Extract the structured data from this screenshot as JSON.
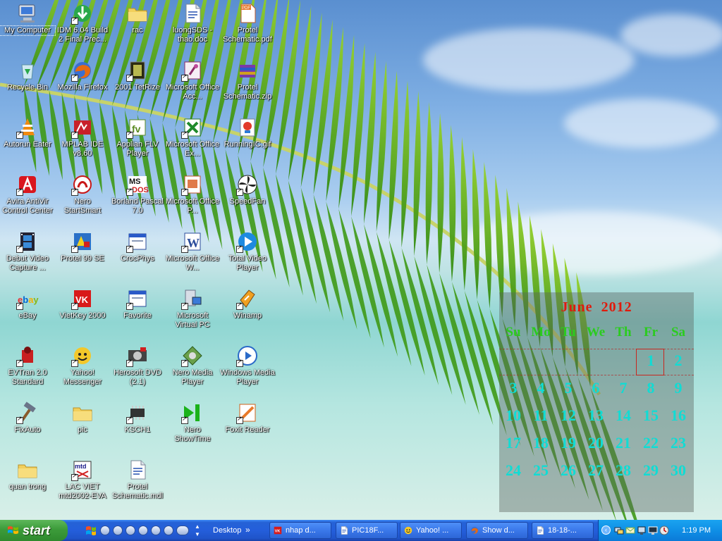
{
  "desktop": {
    "icons": [
      {
        "label": "My Computer",
        "icon": "computer-icon"
      },
      {
        "label": "IDM 6.04 Build 2 Final Prec...",
        "icon": "idm-icon"
      },
      {
        "label": "rac",
        "icon": "folder-icon"
      },
      {
        "label": "luongSDS - thao.doc",
        "icon": "word-doc-icon"
      },
      {
        "label": "Protel Schematic.pdf",
        "icon": "pdf-icon"
      },
      {
        "label": "Recycle Bin",
        "icon": "recycle-bin-icon"
      },
      {
        "label": "Mozilla Firefox",
        "icon": "firefox-icon"
      },
      {
        "label": "2001 TetRize",
        "icon": "tetrize-icon"
      },
      {
        "label": "Microsoft Office Acc...",
        "icon": "access-icon"
      },
      {
        "label": "Protel Schematic.zip",
        "icon": "zip-icon"
      },
      {
        "label": "Autorun Eater",
        "icon": "vlc-cone-icon"
      },
      {
        "label": "MPLAB IDE v8.60",
        "icon": "mplab-icon"
      },
      {
        "label": "Applian FLV Player",
        "icon": "flv-icon"
      },
      {
        "label": "Microsoft Office Ex...",
        "icon": "excel-icon"
      },
      {
        "label": "RunningIC.gif",
        "icon": "gif-icon"
      },
      {
        "label": "Avira AntiVir Control Center",
        "icon": "avira-icon"
      },
      {
        "label": "Nero StartSmart",
        "icon": "nero-icon"
      },
      {
        "label": "Borland Pascal 7.0",
        "icon": "pascal-icon"
      },
      {
        "label": "Microsoft Office P...",
        "icon": "powerpoint-icon"
      },
      {
        "label": "SpeedFan",
        "icon": "fan-icon"
      },
      {
        "label": "Debut Video Capture ...",
        "icon": "film-icon"
      },
      {
        "label": "Protel 99 SE",
        "icon": "protel-icon"
      },
      {
        "label": "CrocPhys",
        "icon": "window-app-icon"
      },
      {
        "label": "Microsoft Office W...",
        "icon": "word-icon"
      },
      {
        "label": "Total Video Player",
        "icon": "play-icon"
      },
      {
        "label": "eBay",
        "icon": "ebay-icon"
      },
      {
        "label": "VietKey 2000",
        "icon": "vietkey-icon"
      },
      {
        "label": "Favorite",
        "icon": "window-app-icon"
      },
      {
        "label": "Microsoft Virtual PC",
        "icon": "virtual-pc-icon"
      },
      {
        "label": "Winamp",
        "icon": "winamp-icon"
      },
      {
        "label": "EVTran 2.0 Standard",
        "icon": "evtran-icon"
      },
      {
        "label": "Yahoo! Messenger",
        "icon": "yahoo-icon"
      },
      {
        "label": "Herosoft DVD (2.1)",
        "icon": "dvd-icon"
      },
      {
        "label": "Nero Media Player",
        "icon": "nero-media-icon"
      },
      {
        "label": "Windows Media Player",
        "icon": "wmp-icon"
      },
      {
        "label": "FixAuto",
        "icon": "hammer-icon"
      },
      {
        "label": "pic",
        "icon": "folder-icon"
      },
      {
        "label": "KSCH1",
        "icon": "chip-icon"
      },
      {
        "label": "Nero ShowTime",
        "icon": "showtime-icon"
      },
      {
        "label": "Foxit Reader",
        "icon": "foxit-icon"
      },
      {
        "label": "quan trong",
        "icon": "folder-icon"
      },
      {
        "label": "LAC VIET mtd2002-EVA",
        "icon": "lacviet-icon"
      },
      {
        "label": "Protel Schematic.mdl",
        "icon": "document-icon"
      }
    ]
  },
  "calendar": {
    "month": "June",
    "year": "2012",
    "weekdays": [
      "Su",
      "Mo",
      "Tu",
      "We",
      "Th",
      "Fr",
      "Sa"
    ],
    "days": [
      "1",
      "2",
      "3",
      "4",
      "5",
      "6",
      "7",
      "8",
      "9",
      "10",
      "11",
      "12",
      "13",
      "14",
      "15",
      "16",
      "17",
      "18",
      "19",
      "20",
      "21",
      "22",
      "23",
      "24",
      "25",
      "26",
      "27",
      "28",
      "29",
      "30"
    ],
    "today": "1",
    "colors": {
      "title": "#e01a0c",
      "weekday": "#2acc1e",
      "day": "#10dcd4"
    }
  },
  "taskbar": {
    "start_label": "start",
    "desktop_label": "Desktop",
    "more_chevron": "»",
    "windows": [
      {
        "label": "nhap d...",
        "icon": "vietkey-icon"
      },
      {
        "label": "PIC18F...",
        "icon": "document-icon"
      },
      {
        "label": "Yahoo! ...",
        "icon": "yahoo-icon"
      },
      {
        "label": "Show d...",
        "icon": "firefox-icon"
      },
      {
        "label": "18-18-...",
        "icon": "word-doc-icon"
      }
    ],
    "clock": "1:19 PM"
  },
  "colors": {
    "taskbar": "#245edb",
    "start": "#3c9b3a",
    "tray": "#0f8fe6"
  }
}
